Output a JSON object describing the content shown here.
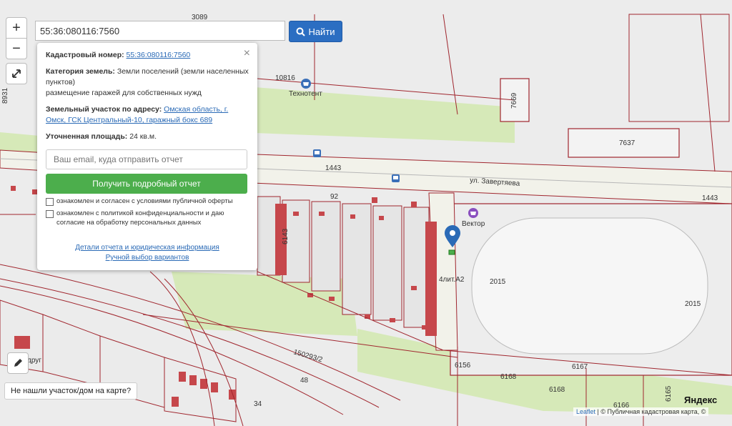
{
  "search": {
    "value": "55:36:080116:7560",
    "button_label": "Найти"
  },
  "zoom": {
    "in_label": "+",
    "out_label": "−"
  },
  "panel": {
    "cad_label": "Кадастровый номер:",
    "cad_value": "55:36:080116:7560",
    "category_label": "Категория земель:",
    "category_value": "Земли поселений (земли населенных пунктов)",
    "usage_value": "размещение гаражей для собственных нужд",
    "address_label": "Земельный участок по адресу:",
    "address_value": "Омская область, г. Омск, ГСК Центральный-10, гаражный бокс 689",
    "area_label": "Уточненная площадь:",
    "area_value": "24 кв.м.",
    "email_placeholder": "Ваш email, куда отправить отчет",
    "report_button": "Получить подробный отчет",
    "check1": "ознакомлен и согласен с условиями публичной оферты",
    "check2": "ознакомлен с политикой конфиденциальности и даю согласие на обработку персональных данных",
    "link_details": "Детали отчета и юридическая информация",
    "link_manual": "Ручной выбор вариантов",
    "close": "×"
  },
  "map_labels": {
    "l3089": "3089",
    "l10816": "10816",
    "tehnotent": "Технотент",
    "l8931": "8931",
    "l7669": "7669",
    "l7637": "7637",
    "l1443a": "1443",
    "l1443b": "1443",
    "street": "ул. Завертяева",
    "l92": "92",
    "vektor": "Вектор",
    "l6143": "6143",
    "plot_label": "4лит.А2",
    "l2015a": "2015",
    "l2015b": "2015",
    "l150293": "150293/2",
    "l48": "48",
    "drug": "друг",
    "l6156": "6156",
    "l6168a": "6168",
    "l6168b": "6168",
    "l6167": "6167",
    "l6166": "6166",
    "l6165": "6165",
    "l34": "34"
  },
  "notfound_label": "Не нашли участок/дом на карте?",
  "yandex_label": "Яндекс",
  "attribution": {
    "leaflet": "Leaflet",
    "text": "| © Публичная кадастровая карта, ©"
  },
  "colors": {
    "parcel_line": "#a0262e",
    "parcel_fill_red": "#d9534f",
    "green_area": "#d4e8b3",
    "road": "#f4f4ef",
    "button_blue": "#2b6ec2",
    "button_green": "#4cae4c",
    "marker_blue": "#2a6ab6"
  },
  "icons": [
    "search-icon",
    "fullscreen-icon",
    "pencil-icon",
    "map-marker-icon",
    "shop-icon",
    "bus-stop-icon",
    "close-icon"
  ]
}
